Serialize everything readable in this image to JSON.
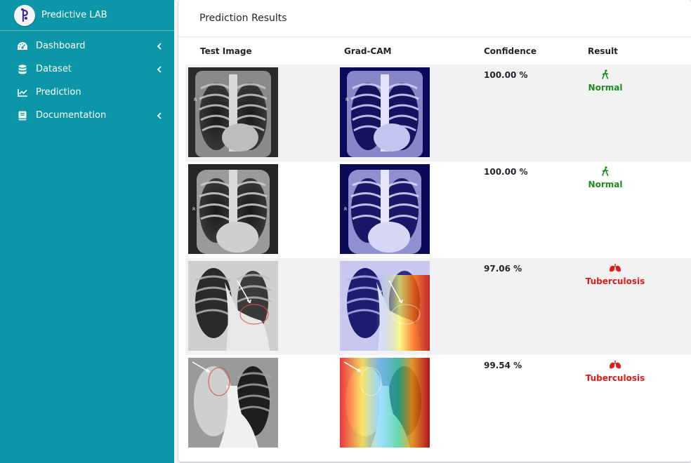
{
  "app": {
    "title": "Predictive LAB",
    "logo_icon": "p-logo-icon"
  },
  "sidebar": {
    "items": [
      {
        "label": "Dashboard",
        "icon": "dashboard-gauge-icon",
        "has_caret": true
      },
      {
        "label": "Dataset",
        "icon": "database-icon",
        "has_caret": true
      },
      {
        "label": "Prediction",
        "icon": "line-chart-icon",
        "has_caret": false
      },
      {
        "label": "Documentation",
        "icon": "book-icon",
        "has_caret": true
      }
    ]
  },
  "card": {
    "title": "Prediction Results"
  },
  "table": {
    "headers": {
      "test": "Test Image",
      "gradcam": "Grad-CAM",
      "confidence": "Confidence",
      "result": "Result"
    },
    "rows": [
      {
        "confidence": "100.00 %",
        "result": "Normal",
        "result_icon": "walking-person-icon",
        "result_color": "#1f8a1f"
      },
      {
        "confidence": "100.00 %",
        "result": "Normal",
        "result_icon": "walking-person-icon",
        "result_color": "#1f8a1f"
      },
      {
        "confidence": "97.06 %",
        "result": "Tuberculosis",
        "result_icon": "lungs-icon",
        "result_color": "#e01b1b"
      },
      {
        "confidence": "99.54 %",
        "result": "Tuberculosis",
        "result_icon": "lungs-icon",
        "result_color": "#e01b1b"
      }
    ]
  }
}
